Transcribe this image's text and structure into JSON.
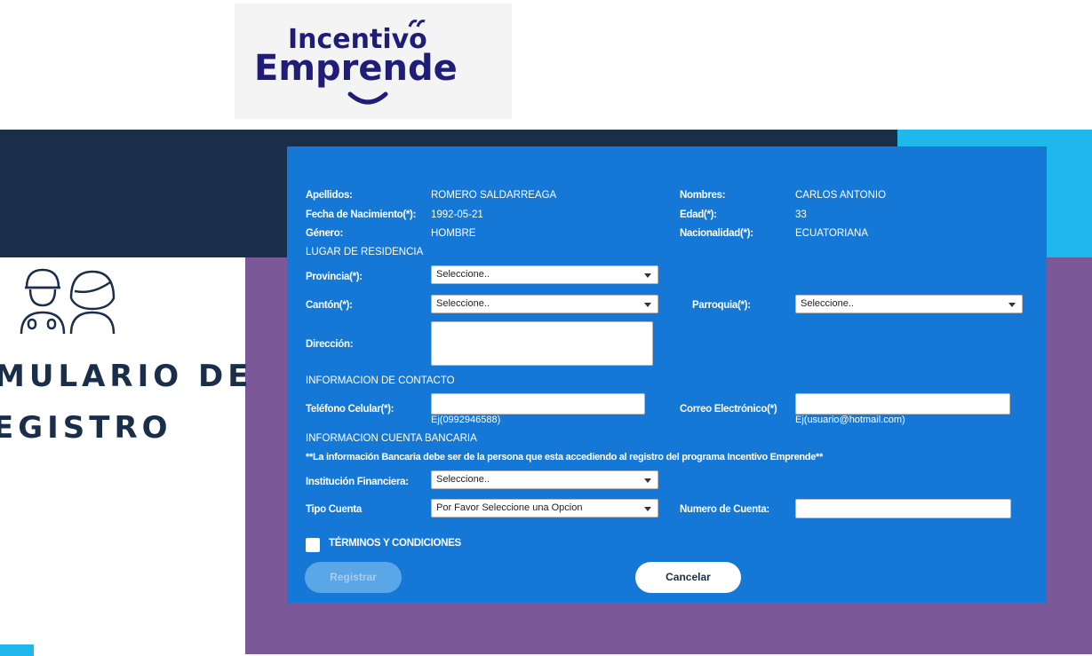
{
  "logo": {
    "line1": "Incentivo",
    "line2": "Emprende"
  },
  "side": {
    "title_line1": "MULARIO DE",
    "title_line2": "EGISTRO"
  },
  "form": {
    "apellidos_label": "Apellidos:",
    "apellidos_value": "ROMERO SALDARREAGA",
    "nombres_label": "Nombres:",
    "nombres_value": "CARLOS ANTONIO",
    "fecha_label": "Fecha de Nacimiento(*):",
    "fecha_value": "1992-05-21",
    "edad_label": "Edad(*):",
    "edad_value": "33",
    "genero_label": "Género:",
    "genero_value": "HOMBRE",
    "nacionalidad_label": "Nacionalidad(*):",
    "nacionalidad_value": "ECUATORIANA",
    "residencia_section": "LUGAR DE RESIDENCIA",
    "provincia_label": "Provincia(*):",
    "provincia_value": "Seleccione..",
    "canton_label": "Cantón(*):",
    "canton_value": "Seleccione..",
    "parroquia_label": "Parroquia(*):",
    "parroquia_value": "Seleccione..",
    "direccion_label": "Dirección:",
    "contacto_section": "INFORMACION DE CONTACTO",
    "telefono_label": "Teléfono Celular(*):",
    "telefono_hint": "Ej(0992946588)",
    "correo_label": "Correo Electrónico(*)",
    "correo_hint": "Ej(usuario@hotmail.com)",
    "bancaria_section": "INFORMACION CUENTA BANCARIA",
    "bancaria_note": "**La información Bancaria debe ser de la persona que esta accediendo al registro del programa Incentivo Emprende**",
    "institucion_label": "Institución Financiera:",
    "institucion_value": "Seleccione..",
    "tipo_label": "Tipo Cuenta",
    "tipo_value": "Por Favor Seleccione una Opcion",
    "numero_label": "Numero de Cuenta:",
    "terminos_label": "TÉRMINOS Y CONDICIONES",
    "registrar_label": "Registrar",
    "cancelar_label": "Cancelar"
  },
  "colors": {
    "panel": "#1678d6",
    "dark": "#1a2e4a",
    "cyan": "#1fb8ec",
    "purple": "#7d5898",
    "logo": "#1f1d78"
  }
}
